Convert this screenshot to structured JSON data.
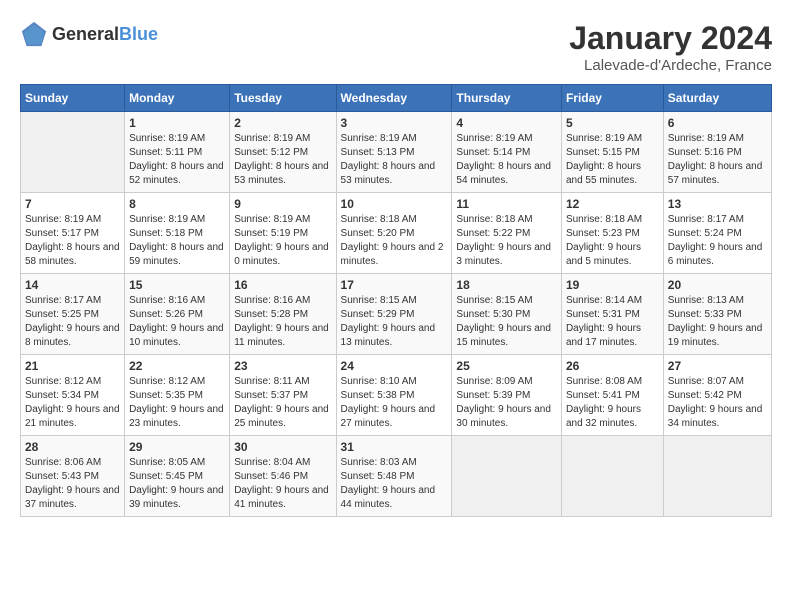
{
  "header": {
    "logo_general": "General",
    "logo_blue": "Blue",
    "month_year": "January 2024",
    "location": "Lalevade-d'Ardeche, France"
  },
  "days_of_week": [
    "Sunday",
    "Monday",
    "Tuesday",
    "Wednesday",
    "Thursday",
    "Friday",
    "Saturday"
  ],
  "weeks": [
    [
      {
        "day": "",
        "sunrise": "",
        "sunset": "",
        "daylight": ""
      },
      {
        "day": "1",
        "sunrise": "Sunrise: 8:19 AM",
        "sunset": "Sunset: 5:11 PM",
        "daylight": "Daylight: 8 hours and 52 minutes."
      },
      {
        "day": "2",
        "sunrise": "Sunrise: 8:19 AM",
        "sunset": "Sunset: 5:12 PM",
        "daylight": "Daylight: 8 hours and 53 minutes."
      },
      {
        "day": "3",
        "sunrise": "Sunrise: 8:19 AM",
        "sunset": "Sunset: 5:13 PM",
        "daylight": "Daylight: 8 hours and 53 minutes."
      },
      {
        "day": "4",
        "sunrise": "Sunrise: 8:19 AM",
        "sunset": "Sunset: 5:14 PM",
        "daylight": "Daylight: 8 hours and 54 minutes."
      },
      {
        "day": "5",
        "sunrise": "Sunrise: 8:19 AM",
        "sunset": "Sunset: 5:15 PM",
        "daylight": "Daylight: 8 hours and 55 minutes."
      },
      {
        "day": "6",
        "sunrise": "Sunrise: 8:19 AM",
        "sunset": "Sunset: 5:16 PM",
        "daylight": "Daylight: 8 hours and 57 minutes."
      }
    ],
    [
      {
        "day": "7",
        "sunrise": "Sunrise: 8:19 AM",
        "sunset": "Sunset: 5:17 PM",
        "daylight": "Daylight: 8 hours and 58 minutes."
      },
      {
        "day": "8",
        "sunrise": "Sunrise: 8:19 AM",
        "sunset": "Sunset: 5:18 PM",
        "daylight": "Daylight: 8 hours and 59 minutes."
      },
      {
        "day": "9",
        "sunrise": "Sunrise: 8:19 AM",
        "sunset": "Sunset: 5:19 PM",
        "daylight": "Daylight: 9 hours and 0 minutes."
      },
      {
        "day": "10",
        "sunrise": "Sunrise: 8:18 AM",
        "sunset": "Sunset: 5:20 PM",
        "daylight": "Daylight: 9 hours and 2 minutes."
      },
      {
        "day": "11",
        "sunrise": "Sunrise: 8:18 AM",
        "sunset": "Sunset: 5:22 PM",
        "daylight": "Daylight: 9 hours and 3 minutes."
      },
      {
        "day": "12",
        "sunrise": "Sunrise: 8:18 AM",
        "sunset": "Sunset: 5:23 PM",
        "daylight": "Daylight: 9 hours and 5 minutes."
      },
      {
        "day": "13",
        "sunrise": "Sunrise: 8:17 AM",
        "sunset": "Sunset: 5:24 PM",
        "daylight": "Daylight: 9 hours and 6 minutes."
      }
    ],
    [
      {
        "day": "14",
        "sunrise": "Sunrise: 8:17 AM",
        "sunset": "Sunset: 5:25 PM",
        "daylight": "Daylight: 9 hours and 8 minutes."
      },
      {
        "day": "15",
        "sunrise": "Sunrise: 8:16 AM",
        "sunset": "Sunset: 5:26 PM",
        "daylight": "Daylight: 9 hours and 10 minutes."
      },
      {
        "day": "16",
        "sunrise": "Sunrise: 8:16 AM",
        "sunset": "Sunset: 5:28 PM",
        "daylight": "Daylight: 9 hours and 11 minutes."
      },
      {
        "day": "17",
        "sunrise": "Sunrise: 8:15 AM",
        "sunset": "Sunset: 5:29 PM",
        "daylight": "Daylight: 9 hours and 13 minutes."
      },
      {
        "day": "18",
        "sunrise": "Sunrise: 8:15 AM",
        "sunset": "Sunset: 5:30 PM",
        "daylight": "Daylight: 9 hours and 15 minutes."
      },
      {
        "day": "19",
        "sunrise": "Sunrise: 8:14 AM",
        "sunset": "Sunset: 5:31 PM",
        "daylight": "Daylight: 9 hours and 17 minutes."
      },
      {
        "day": "20",
        "sunrise": "Sunrise: 8:13 AM",
        "sunset": "Sunset: 5:33 PM",
        "daylight": "Daylight: 9 hours and 19 minutes."
      }
    ],
    [
      {
        "day": "21",
        "sunrise": "Sunrise: 8:12 AM",
        "sunset": "Sunset: 5:34 PM",
        "daylight": "Daylight: 9 hours and 21 minutes."
      },
      {
        "day": "22",
        "sunrise": "Sunrise: 8:12 AM",
        "sunset": "Sunset: 5:35 PM",
        "daylight": "Daylight: 9 hours and 23 minutes."
      },
      {
        "day": "23",
        "sunrise": "Sunrise: 8:11 AM",
        "sunset": "Sunset: 5:37 PM",
        "daylight": "Daylight: 9 hours and 25 minutes."
      },
      {
        "day": "24",
        "sunrise": "Sunrise: 8:10 AM",
        "sunset": "Sunset: 5:38 PM",
        "daylight": "Daylight: 9 hours and 27 minutes."
      },
      {
        "day": "25",
        "sunrise": "Sunrise: 8:09 AM",
        "sunset": "Sunset: 5:39 PM",
        "daylight": "Daylight: 9 hours and 30 minutes."
      },
      {
        "day": "26",
        "sunrise": "Sunrise: 8:08 AM",
        "sunset": "Sunset: 5:41 PM",
        "daylight": "Daylight: 9 hours and 32 minutes."
      },
      {
        "day": "27",
        "sunrise": "Sunrise: 8:07 AM",
        "sunset": "Sunset: 5:42 PM",
        "daylight": "Daylight: 9 hours and 34 minutes."
      }
    ],
    [
      {
        "day": "28",
        "sunrise": "Sunrise: 8:06 AM",
        "sunset": "Sunset: 5:43 PM",
        "daylight": "Daylight: 9 hours and 37 minutes."
      },
      {
        "day": "29",
        "sunrise": "Sunrise: 8:05 AM",
        "sunset": "Sunset: 5:45 PM",
        "daylight": "Daylight: 9 hours and 39 minutes."
      },
      {
        "day": "30",
        "sunrise": "Sunrise: 8:04 AM",
        "sunset": "Sunset: 5:46 PM",
        "daylight": "Daylight: 9 hours and 41 minutes."
      },
      {
        "day": "31",
        "sunrise": "Sunrise: 8:03 AM",
        "sunset": "Sunset: 5:48 PM",
        "daylight": "Daylight: 9 hours and 44 minutes."
      },
      {
        "day": "",
        "sunrise": "",
        "sunset": "",
        "daylight": ""
      },
      {
        "day": "",
        "sunrise": "",
        "sunset": "",
        "daylight": ""
      },
      {
        "day": "",
        "sunrise": "",
        "sunset": "",
        "daylight": ""
      }
    ]
  ]
}
